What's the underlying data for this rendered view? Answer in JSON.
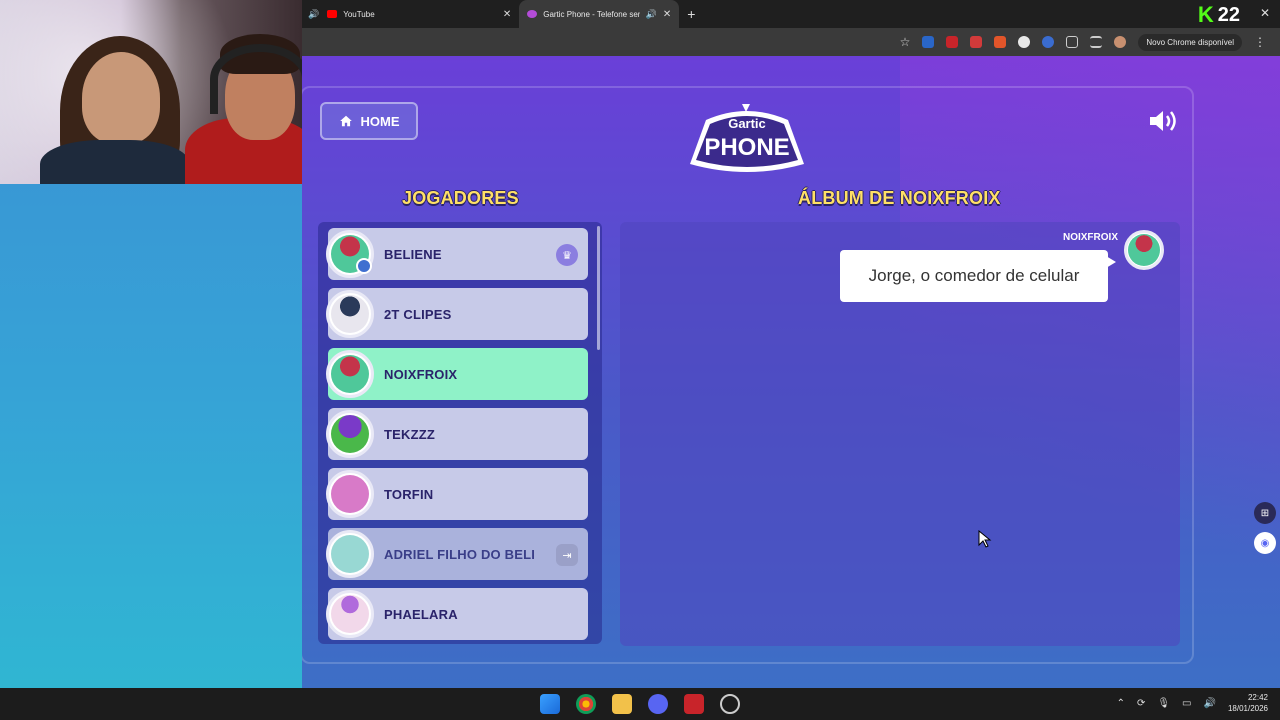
{
  "browser": {
    "tabs": [
      {
        "title": "YouTube",
        "muted_icon": "speaker-icon"
      },
      {
        "title": "Gartic Phone - Telefone sem fio",
        "active": true
      }
    ],
    "kick_count": "22",
    "update_label": "Novo Chrome disponível"
  },
  "game": {
    "home_label": "HOME",
    "logo_top": "Gartic",
    "logo_bottom": "PHONE",
    "players_title": "JOGADORES",
    "album_title": "ÁLBUM DE NOIXFROIX",
    "players": [
      {
        "name": "BELIENE",
        "badge": "crown-icon",
        "owner": true
      },
      {
        "name": "2T CLIPES"
      },
      {
        "name": "NOIXFROIX",
        "active": true
      },
      {
        "name": "TEKZZZ"
      },
      {
        "name": "TORFIN"
      },
      {
        "name": "ADRIEL FILHO DO BELI",
        "badge": "exit-icon",
        "away": true
      },
      {
        "name": "PHAELARA"
      }
    ],
    "album": {
      "author": "NOIXFROIX",
      "entry_text": "Jorge, o comedor de celular"
    }
  },
  "taskbar": {
    "time": "22:42",
    "date": "18/01/2026"
  },
  "colors": {
    "accent_yellow": "#ffe066",
    "active_player": "#8ff2c8",
    "player_bg": "#c7cae8"
  }
}
